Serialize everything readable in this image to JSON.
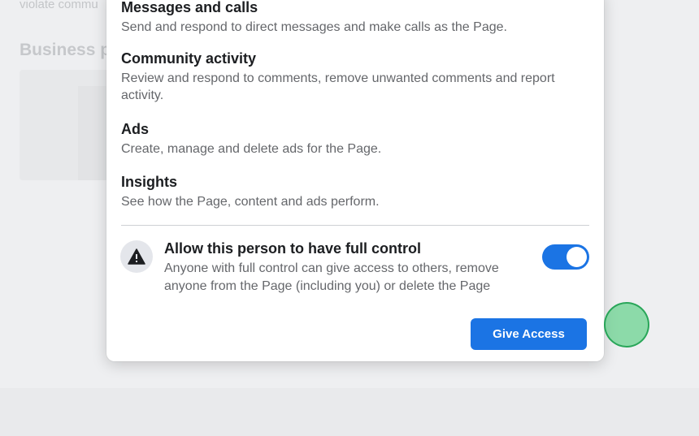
{
  "background": {
    "top_text": "violate commu",
    "heading": "Business p"
  },
  "modal": {
    "permissions": [
      {
        "title": "Messages and calls",
        "description": "Send and respond to direct messages and make calls as the Page."
      },
      {
        "title": "Community activity",
        "description": "Review and respond to comments, remove unwanted comments and report activity."
      },
      {
        "title": "Ads",
        "description": "Create, manage and delete ads for the Page."
      },
      {
        "title": "Insights",
        "description": "See how the Page, content and ads perform."
      }
    ],
    "full_control": {
      "icon": "warning-icon",
      "title": "Allow this person to have full control",
      "description": "Anyone with full control can give access to others, remove anyone from the Page (including you) or delete the Page",
      "enabled": true
    },
    "give_access_label": "Give Access"
  },
  "colors": {
    "accent": "#1b74e4",
    "click_indicator": "#3cc86e"
  }
}
